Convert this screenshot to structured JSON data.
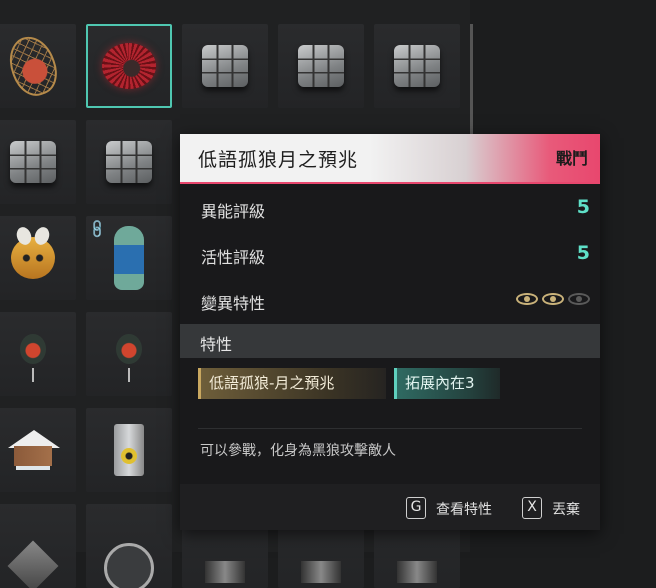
{
  "tooltip": {
    "title": "低語孤狼月之預兆",
    "tag": "戰鬥",
    "accent_color": "#e8476e",
    "stats": [
      {
        "label": "異能評級",
        "value": "5"
      },
      {
        "label": "活性評級",
        "value": "5"
      },
      {
        "label": "變異特性",
        "value": ""
      }
    ],
    "mutation_eyes": {
      "filled": 2,
      "total": 3
    },
    "section_title": "特性",
    "traits": [
      {
        "label": "低語孤狼-月之預兆"
      },
      {
        "label": "拓展內在3"
      }
    ],
    "description": "可以參戰，化身為黑狼攻擊敵人",
    "actions": [
      {
        "key": "G",
        "label": "查看特性"
      },
      {
        "key": "X",
        "label": "丟棄"
      }
    ]
  },
  "inventory": {
    "items": [
      {
        "icon": "net-trap-icon"
      },
      {
        "icon": "spiky-creature-icon",
        "selected": true
      },
      {
        "icon": "cube-icon"
      },
      {
        "icon": "cube-icon"
      },
      {
        "icon": "cube-icon"
      },
      {
        "icon": "cube-icon"
      },
      {
        "icon": "cube-icon"
      },
      {
        "icon": "bee-pet-icon"
      },
      {
        "icon": "dino-figure-icon",
        "linked": true
      },
      {
        "icon": "grenade-icon"
      },
      {
        "icon": "grenade-icon"
      },
      {
        "icon": "snow-cabin-icon"
      },
      {
        "icon": "lighter-icon"
      }
    ]
  },
  "colors": {
    "selection": "#4fc7b1",
    "value_text": "#5fe0c8",
    "eye_gold": "#c9b27a",
    "eye_dim": "#5a5a5a"
  }
}
